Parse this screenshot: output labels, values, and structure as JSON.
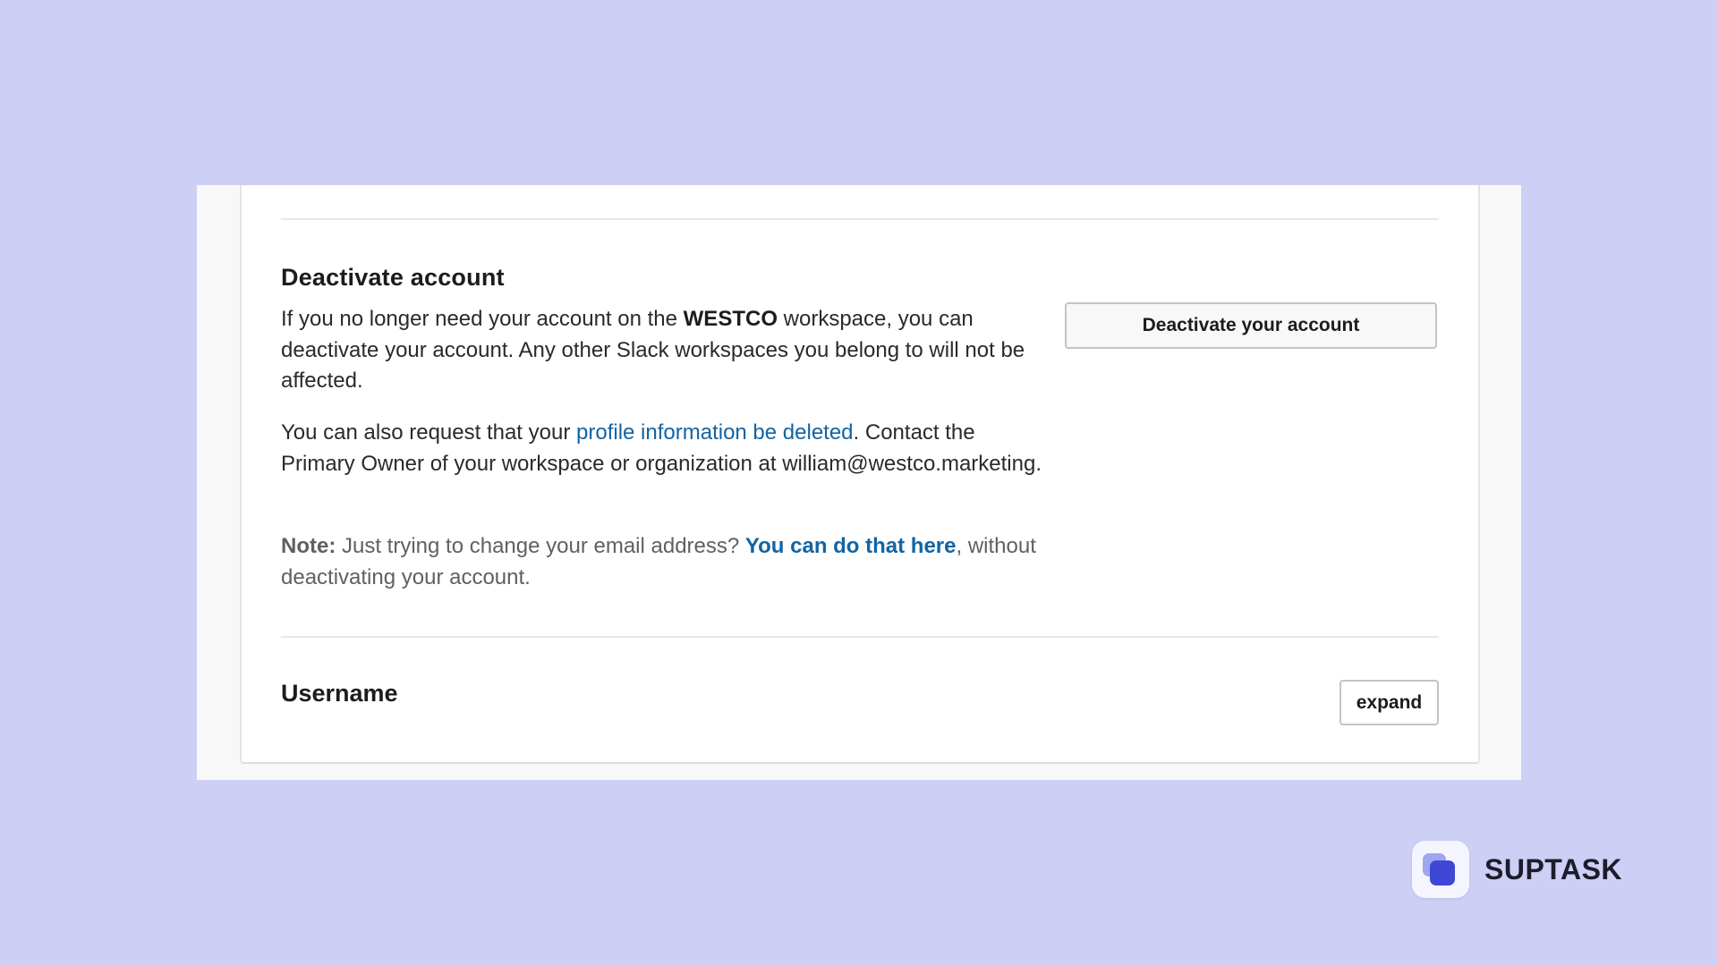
{
  "deactivate": {
    "title": "Deactivate account",
    "p1_prefix": "If you no longer need your account on the ",
    "workspace": "WESTCO",
    "p1_suffix": " workspace, you can deactivate your account. Any other Slack workspaces you belong to will not be affected.",
    "p2_prefix": "You can also request that your ",
    "p2_link": "profile information be deleted",
    "p2_suffix": ". Contact the Primary Owner of your workspace or organization at william@westco.marketing.",
    "note_label": "Note:",
    "note_text": " Just trying to change your email address? ",
    "note_link": "You can do that here",
    "note_suffix": ", without deactivating your account.",
    "button_label": "Deactivate your account"
  },
  "username": {
    "title": "Username",
    "expand_label": "expand"
  },
  "brand": {
    "name": "SUPTASK",
    "logo_icon": "suptask-logo-icon"
  },
  "colors": {
    "background": "#cdd0f4",
    "link": "#1264a3",
    "brand_accent": "#3f47d6"
  }
}
